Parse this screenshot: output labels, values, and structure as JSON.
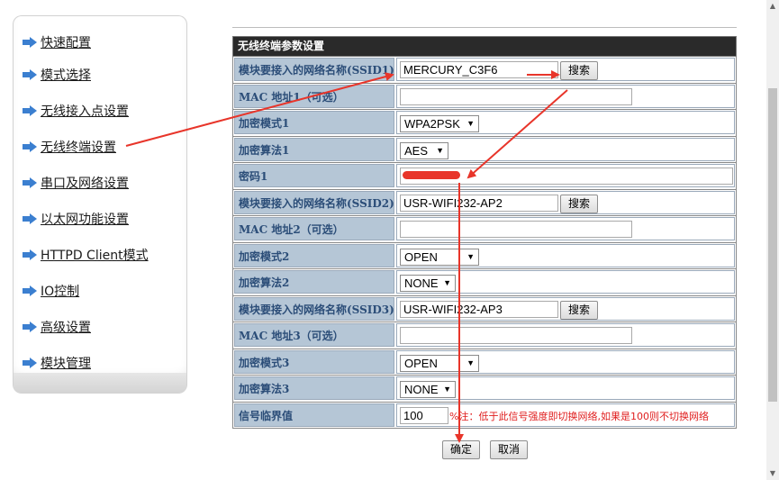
{
  "sidebar": {
    "items": [
      {
        "label": "快速配置"
      },
      {
        "label": "模式选择"
      },
      {
        "label": "无线接入点设置"
      },
      {
        "label": "无线终端设置"
      },
      {
        "label": "串口及网络设置"
      },
      {
        "label": "以太网功能设置"
      },
      {
        "label": "HTTPD Client模式"
      },
      {
        "label": "IO控制"
      },
      {
        "label": "高级设置"
      },
      {
        "label": "模块管理"
      }
    ]
  },
  "panel": {
    "title": "无线终端参数设置",
    "rows": [
      {
        "label": "模块要接入的网络名称(SSID1)",
        "ssid": "MERCURY_C3F6",
        "button": "搜索"
      },
      {
        "label": "MAC 地址1（可选）",
        "mac": ""
      },
      {
        "label": "加密模式1",
        "value": "WPA2PSK"
      },
      {
        "label": "加密算法1",
        "value": "AES"
      },
      {
        "label": "密码1",
        "password": ""
      },
      {
        "label": "模块要接入的网络名称(SSID2)",
        "ssid": "USR-WIFI232-AP2",
        "button": "搜索"
      },
      {
        "label": "MAC 地址2（可选）",
        "mac": ""
      },
      {
        "label": "加密模式2",
        "value": "OPEN"
      },
      {
        "label": "加密算法2",
        "value": "NONE"
      },
      {
        "label": "模块要接入的网络名称(SSID3)",
        "ssid": "USR-WIFI232-AP3",
        "button": "搜索"
      },
      {
        "label": "MAC 地址3（可选）",
        "mac": ""
      },
      {
        "label": "加密模式3",
        "value": "OPEN"
      },
      {
        "label": "加密算法3",
        "value": "NONE"
      },
      {
        "label": "信号临界值",
        "value": "100",
        "note": "%注：低于此信号强度即切换网络,如果是100则不切换网络"
      }
    ]
  },
  "actions": {
    "confirm": "确定",
    "cancel": "取消"
  },
  "colors": {
    "annotation_arrow": "#e8352a",
    "header_bg": "#2a2a2a",
    "label_bg": "#b5c6d6",
    "label_text": "#2b4d78",
    "note_text": "#e02020"
  }
}
